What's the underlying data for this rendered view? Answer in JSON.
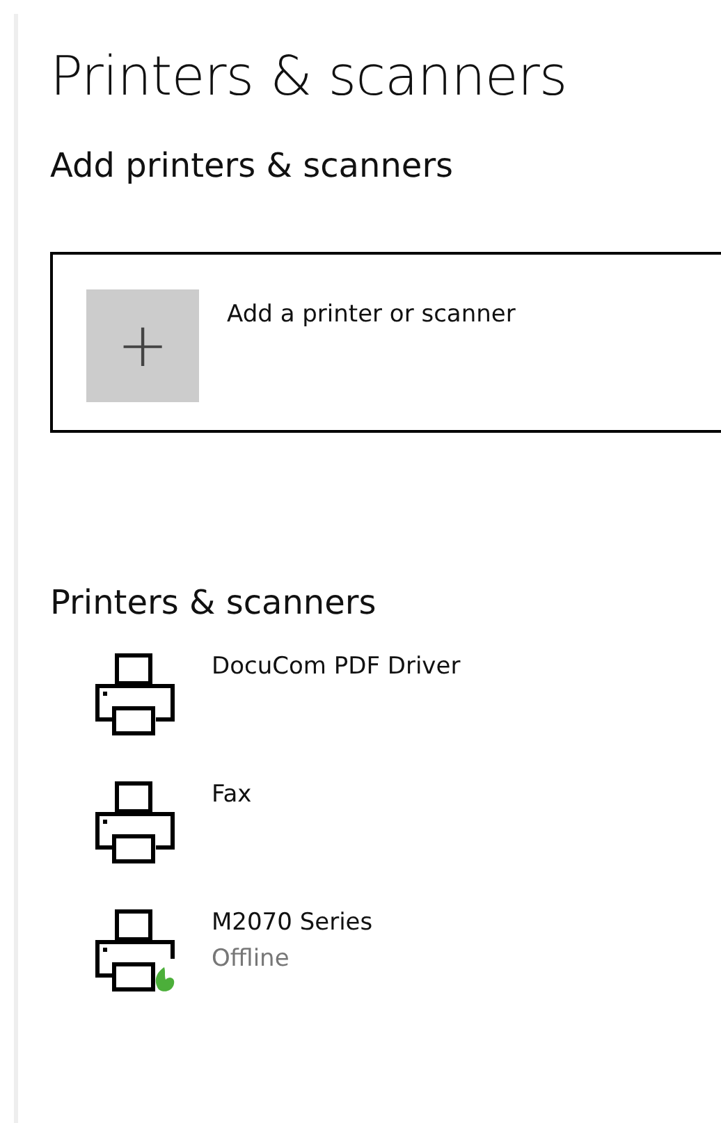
{
  "title": "Printers & scanners",
  "add_section": {
    "heading": "Add printers & scanners",
    "button": {
      "icon": "+",
      "label": "Add a printer or scanner"
    }
  },
  "devices_section": {
    "heading": "Printers & scanners",
    "devices": [
      {
        "name": "DocuCom PDF Driver",
        "kind": "plain"
      },
      {
        "name": "Fax",
        "kind": "plain"
      },
      {
        "name": "M2070 Series",
        "status": "Offline",
        "kind": "badged"
      }
    ]
  }
}
